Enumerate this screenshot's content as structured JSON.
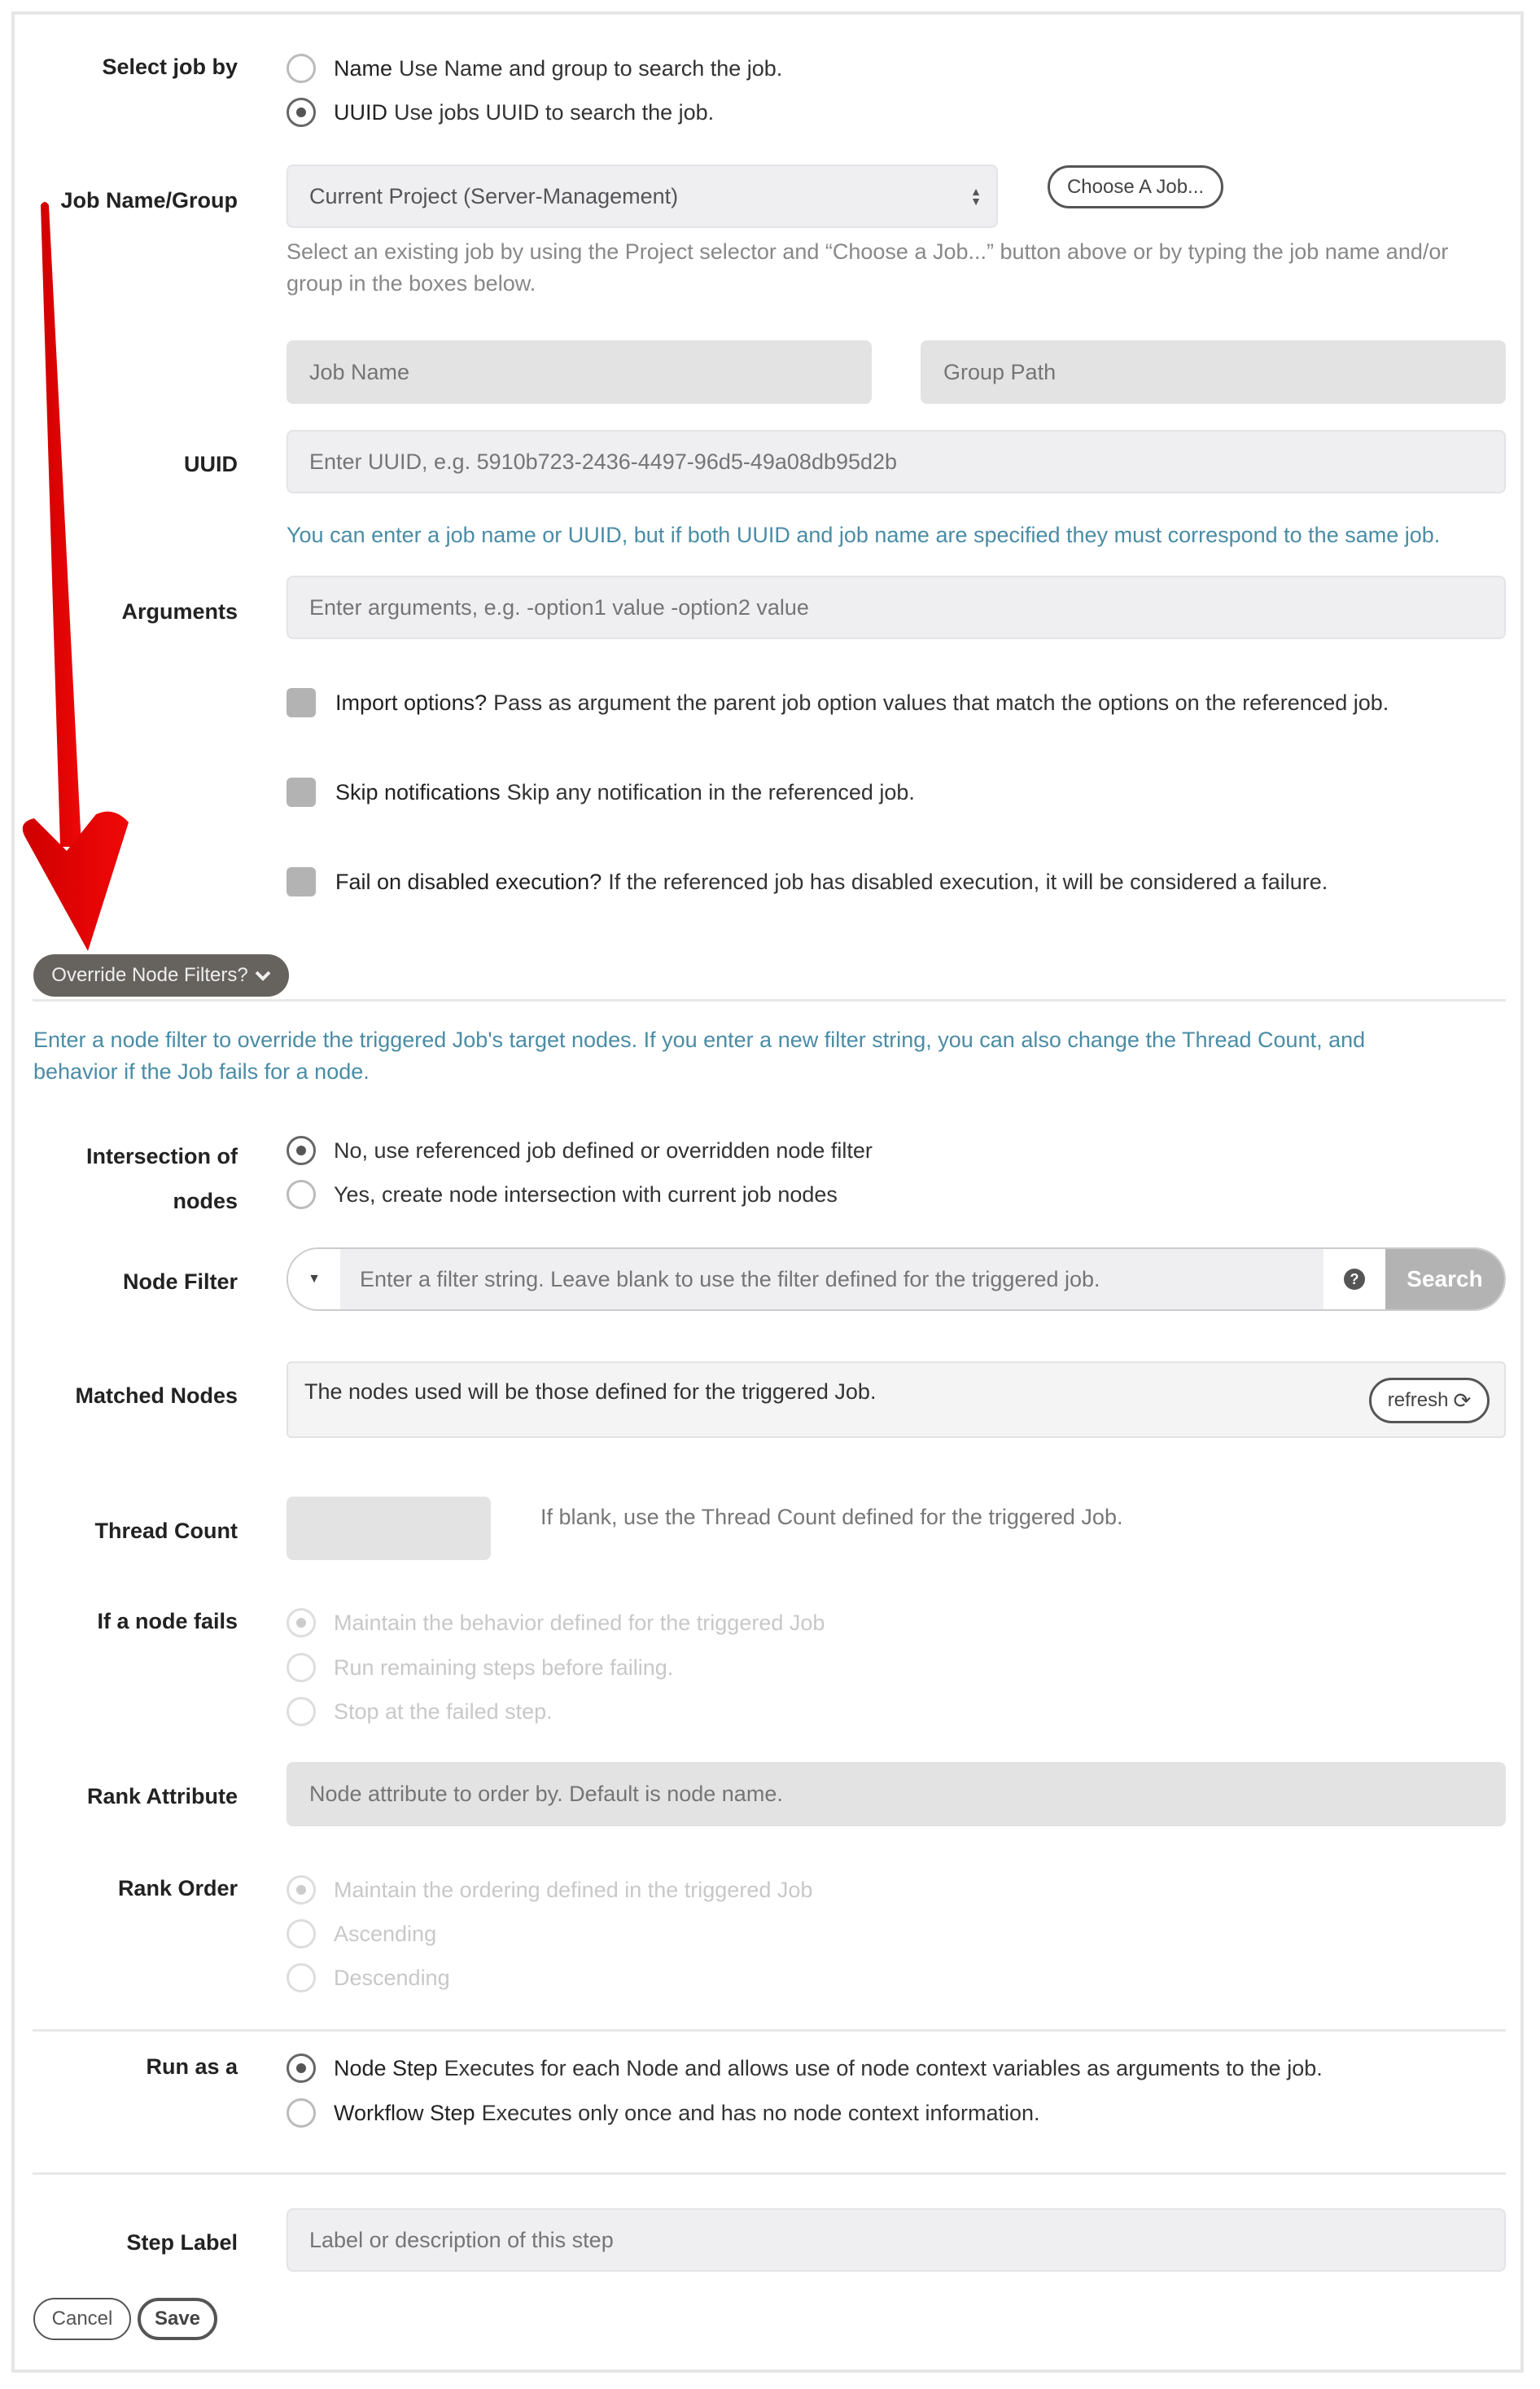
{
  "select_job_by": {
    "label": "Select job by",
    "options": [
      {
        "name": "Name",
        "desc": "Use Name and group to search the job.",
        "selected": false
      },
      {
        "name": "UUID",
        "desc": "Use jobs UUID to search the job.",
        "selected": true
      }
    ]
  },
  "job_name_group": {
    "label": "Job Name/Group",
    "project_select_value": "Current Project (Server-Management)",
    "choose_job_button": "Choose A Job...",
    "help_line1": "Select an existing job by using the Project selector and “Choose a Job...” button above or by typing the job name and/or",
    "help_line2": "group in the boxes below.",
    "job_name_placeholder": "Job Name",
    "group_path_placeholder": "Group Path"
  },
  "uuid": {
    "label": "UUID",
    "placeholder": "Enter UUID, e.g. 5910b723-2436-4497-96d5-49a08db95d2b",
    "note": "You can enter a job name or UUID, but if both UUID and job name are specified they must correspond to the same job."
  },
  "arguments": {
    "label": "Arguments",
    "placeholder": "Enter arguments, e.g. -option1 value -option2 value"
  },
  "checkboxes": [
    {
      "name": "Import options?",
      "desc": "Pass as argument the parent job option values that match the options on the referenced job.",
      "checked": false
    },
    {
      "name": "Skip notifications",
      "desc": "Skip any notification in the referenced job.",
      "checked": false
    },
    {
      "name": "Fail on disabled execution?",
      "desc": "If the referenced job has disabled execution, it will be considered a failure.",
      "checked": false
    }
  ],
  "override": {
    "button_label": "Override Node Filters?",
    "icon": "chevron-down-icon",
    "desc_line1": "Enter a node filter to override the triggered Job's target nodes. If you enter a new filter string, you can also change the Thread Count, and",
    "desc_line2": "behavior if the Job fails for a node."
  },
  "intersection": {
    "label_line1": "Intersection of",
    "label_line2": "nodes",
    "options": [
      {
        "label": "No, use referenced job defined or overridden node filter",
        "selected": true
      },
      {
        "label": "Yes, create node intersection with current job nodes",
        "selected": false
      }
    ]
  },
  "node_filter": {
    "label": "Node Filter",
    "placeholder": "Enter a filter string. Leave blank to use the filter defined for the triggered job.",
    "help_icon": "question-circle-icon",
    "search_button": "Search"
  },
  "matched_nodes": {
    "label": "Matched Nodes",
    "text": "The nodes used will be those defined for the triggered Job.",
    "refresh_button": "refresh"
  },
  "thread_count": {
    "label": "Thread Count",
    "value": "",
    "help": "If blank, use the Thread Count defined for the triggered Job."
  },
  "node_fails": {
    "label": "If a node fails",
    "options": [
      {
        "label": "Maintain the behavior defined for the triggered Job",
        "selected": true
      },
      {
        "label": "Run remaining steps before failing.",
        "selected": false
      },
      {
        "label": "Stop at the failed step.",
        "selected": false
      }
    ]
  },
  "rank_attribute": {
    "label": "Rank Attribute",
    "placeholder": "Node attribute to order by. Default is node name."
  },
  "rank_order": {
    "label": "Rank Order",
    "options": [
      {
        "label": "Maintain the ordering defined in the triggered Job",
        "selected": true
      },
      {
        "label": "Ascending",
        "selected": false
      },
      {
        "label": "Descending",
        "selected": false
      }
    ]
  },
  "run_as": {
    "label": "Run as a",
    "options": [
      {
        "name": "Node Step",
        "desc": "Executes for each Node and allows use of node context variables as arguments to the job.",
        "selected": true
      },
      {
        "name": "Workflow Step",
        "desc": "Executes only once and has no node context information.",
        "selected": false
      }
    ]
  },
  "step_label": {
    "label": "Step Label",
    "placeholder": "Label or description of this step"
  },
  "footer": {
    "cancel": "Cancel",
    "save": "Save"
  },
  "annotation": {
    "type": "red-arrow",
    "color": "#e60000",
    "points_to": "Override Node Filters?"
  }
}
